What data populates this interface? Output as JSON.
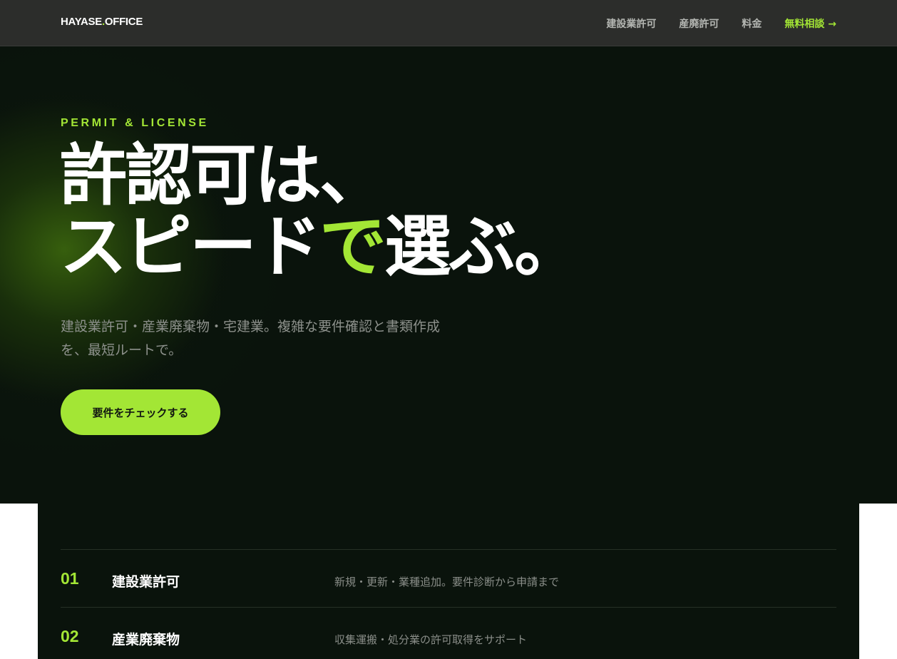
{
  "header": {
    "logo_prefix": "HAYASE",
    "logo_dot": ".",
    "logo_suffix": "OFFICE",
    "nav": [
      {
        "label": "建設業許可"
      },
      {
        "label": "産廃許可"
      },
      {
        "label": "料金"
      }
    ],
    "cta_label": "無料相談 →"
  },
  "hero": {
    "eyebrow": "PERMIT & LICENSE",
    "headline_line1": "許認可は、",
    "headline_line2_pre": "スピード",
    "headline_line2_accent": "で",
    "headline_line2_post": "選ぶ。",
    "lead_line1": "建設業許可・産業廃棄物・宅建業。複雑な要件確認と書類作成",
    "lead_line2": "を、最短ルートで。",
    "button_label": "要件をチェックする"
  },
  "services": [
    {
      "num": "01",
      "name": "建設業許可",
      "desc": "新規・更新・業種追加。要件診断から申請まで"
    },
    {
      "num": "02",
      "name": "産業廃棄物",
      "desc": "収集運搬・処分業の許可取得をサポート"
    }
  ],
  "colors": {
    "accent": "#a3e635",
    "header_bg": "#2c2d2b",
    "hero_bg": "#0a130c"
  }
}
